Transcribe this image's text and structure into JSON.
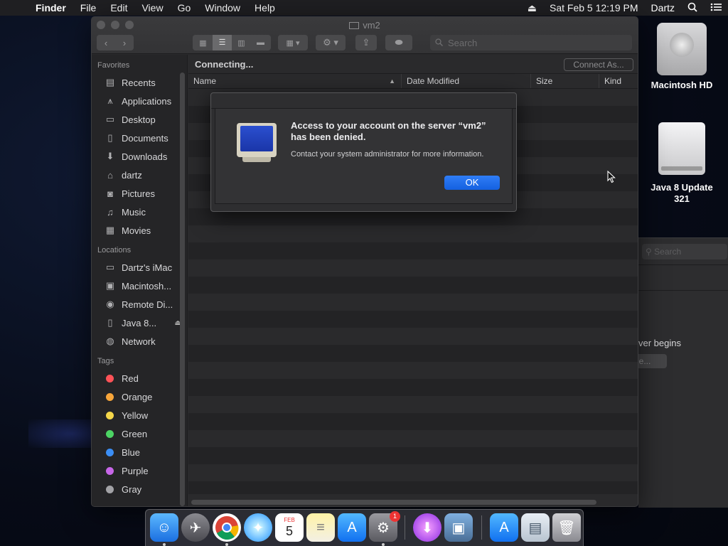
{
  "menubar": {
    "app_name": "Finder",
    "items": [
      "File",
      "Edit",
      "View",
      "Go",
      "Window",
      "Help"
    ],
    "datetime": "Sat Feb 5  12:19 PM",
    "user": "Dartz"
  },
  "finder": {
    "title": "vm2",
    "search_placeholder": "Search",
    "status": "Connecting...",
    "connect_as": "Connect As...",
    "columns": {
      "name": "Name",
      "date": "Date Modified",
      "size": "Size",
      "kind": "Kind"
    }
  },
  "sidebar": {
    "favorites_label": "Favorites",
    "favorites": [
      {
        "label": "Recents",
        "icon": "clock-icon"
      },
      {
        "label": "Applications",
        "icon": "applications-icon"
      },
      {
        "label": "Desktop",
        "icon": "desktop-icon"
      },
      {
        "label": "Documents",
        "icon": "document-icon"
      },
      {
        "label": "Downloads",
        "icon": "download-icon"
      },
      {
        "label": "dartz",
        "icon": "home-icon"
      },
      {
        "label": "Pictures",
        "icon": "camera-icon"
      },
      {
        "label": "Music",
        "icon": "music-note-icon"
      },
      {
        "label": "Movies",
        "icon": "film-icon"
      }
    ],
    "locations_label": "Locations",
    "locations": [
      {
        "label": "Dartz's iMac",
        "icon": "imac-icon"
      },
      {
        "label": "Macintosh...",
        "icon": "hard-disk-icon"
      },
      {
        "label": "Remote Di...",
        "icon": "disc-icon"
      },
      {
        "label": "Java 8...",
        "icon": "drive-icon"
      },
      {
        "label": "Network",
        "icon": "globe-icon"
      }
    ],
    "tags_label": "Tags",
    "tags": [
      {
        "label": "Red",
        "color": "#ff5257"
      },
      {
        "label": "Orange",
        "color": "#f7a53a"
      },
      {
        "label": "Yellow",
        "color": "#f5d74a"
      },
      {
        "label": "Green",
        "color": "#4cd464"
      },
      {
        "label": "Blue",
        "color": "#3b8ef5"
      },
      {
        "label": "Purple",
        "color": "#c766e8"
      },
      {
        "label": "Gray",
        "color": "#a2a2a6"
      }
    ]
  },
  "dialog": {
    "title": "Access to your account on the server “vm2” has been denied.",
    "message": "Contact your system administrator for more information.",
    "ok_label": "OK"
  },
  "desktop": {
    "icons": [
      {
        "label": "Macintosh HD"
      },
      {
        "label": "Java 8 Update 321"
      }
    ]
  },
  "background_window": {
    "search_placeholder": "Search",
    "text_fragment": "ver begins",
    "button_fragment": "ge..."
  },
  "dock": {
    "calendar_month": "FEB",
    "calendar_day": "5",
    "badge_count": "1"
  }
}
